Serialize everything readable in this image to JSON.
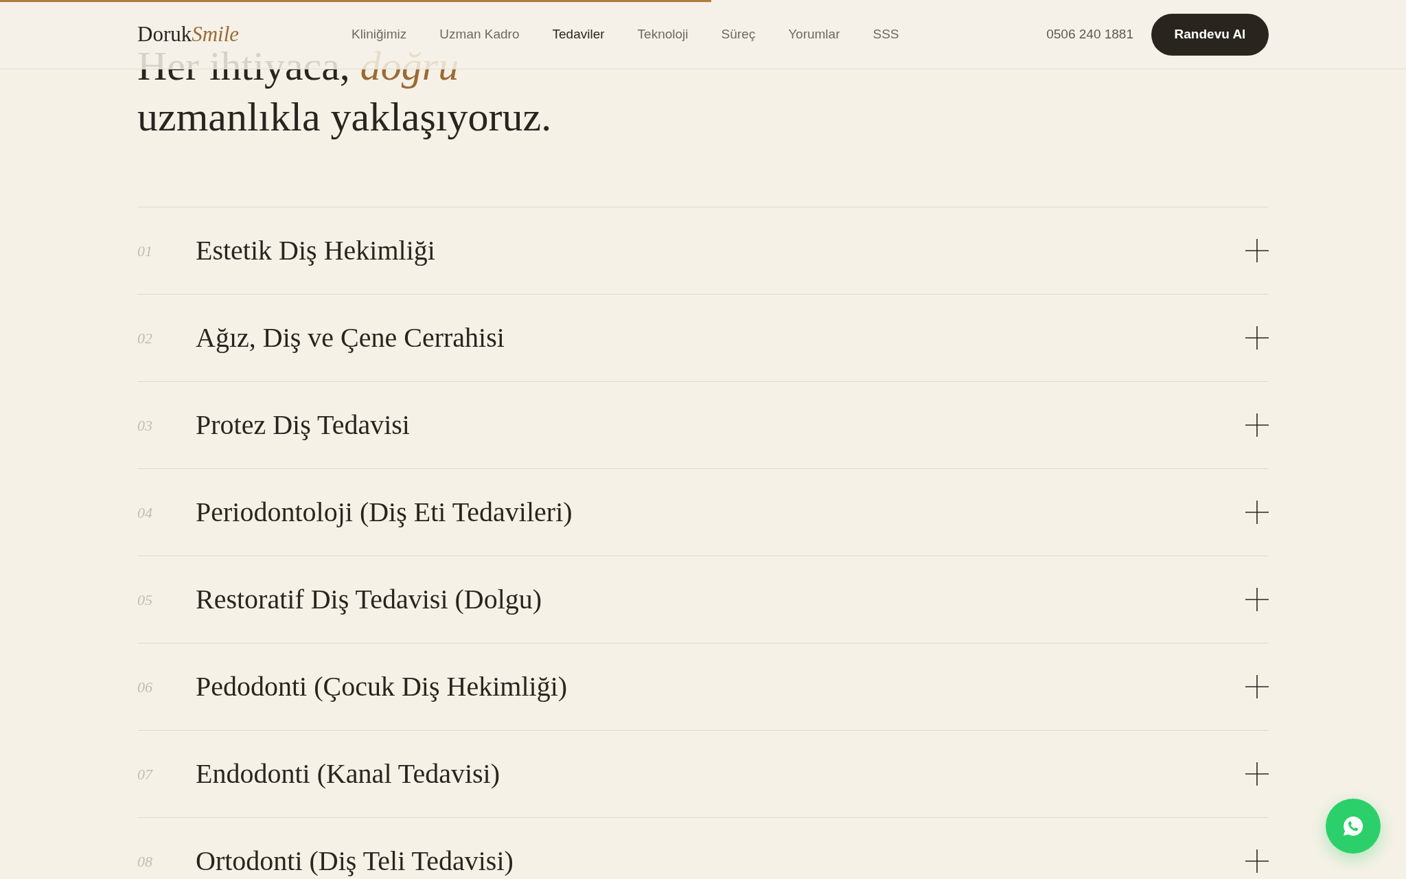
{
  "scroll_progress": {
    "level": 0.506
  },
  "header": {
    "logo": {
      "first": "Doruk",
      "second": "Smile"
    },
    "nav": [
      {
        "label": "Kliniğimiz",
        "selected": false
      },
      {
        "label": "Uzman Kadro",
        "selected": false
      },
      {
        "label": "Tedaviler",
        "selected": true
      },
      {
        "label": "Teknoloji",
        "selected": false
      },
      {
        "label": "Süreç",
        "selected": false
      },
      {
        "label": "Yorumlar",
        "selected": false
      },
      {
        "label": "SSS",
        "selected": false
      }
    ],
    "phone": "0506 240 1881",
    "cta": "Randevu Al"
  },
  "heading": {
    "line_1": "Her ihtiyaca, *doğru*",
    "line_2": "uzmanlıkla yaklaşıyoruz."
  },
  "treatments": [
    {
      "number": "01",
      "title": "Estetik Diş Hekimliği",
      "expanded": false
    },
    {
      "number": "02",
      "title": "Ağız, Diş ve Çene Cerrahisi",
      "expanded": false
    },
    {
      "number": "03",
      "title": "Protez Diş Tedavisi",
      "expanded": false
    },
    {
      "number": "04",
      "title": "Periodontoloji (Diş Eti Tedavileri)",
      "expanded": false
    },
    {
      "number": "05",
      "title": "Restoratif Diş Tedavisi (Dolgu)",
      "expanded": false
    },
    {
      "number": "06",
      "title": "Pedodonti (Çocuk Diş Hekimliği)",
      "expanded": false
    },
    {
      "number": "07",
      "title": "Endodonti (Kanal Tedavisi)",
      "expanded": false
    },
    {
      "number": "08",
      "title": "Ortodonti (Diş Teli Tedavisi)",
      "expanded": false
    }
  ]
}
